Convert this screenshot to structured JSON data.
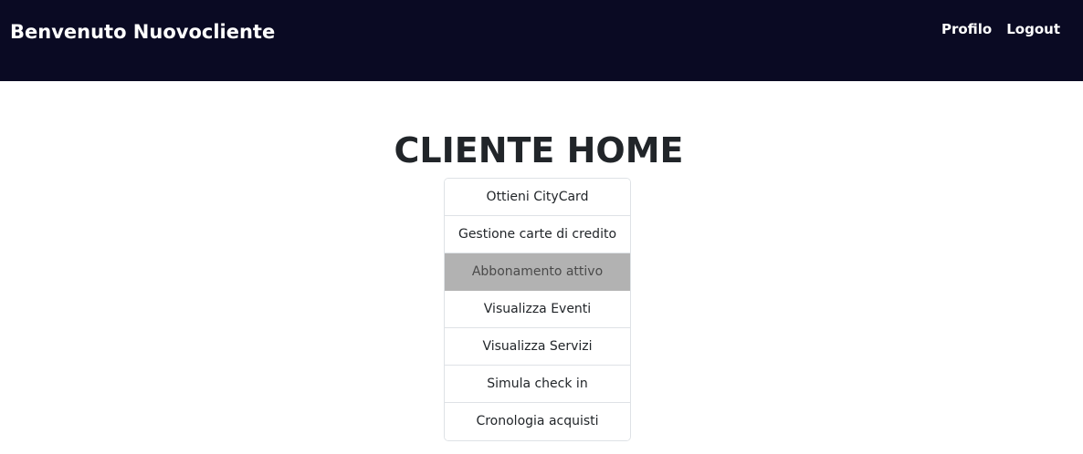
{
  "header": {
    "brand": "Benvenuto Nuovocliente",
    "links": [
      "Profilo",
      "Logout"
    ]
  },
  "main": {
    "title": "CLIENTE HOME",
    "menu": [
      {
        "label": "Ottieni CityCard",
        "active": false
      },
      {
        "label": "Gestione carte di credito",
        "active": false
      },
      {
        "label": "Abbonamento attivo",
        "active": true
      },
      {
        "label": "Visualizza Eventi",
        "active": false
      },
      {
        "label": "Visualizza Servizi",
        "active": false
      },
      {
        "label": "Simula check in",
        "active": false
      },
      {
        "label": "Cronologia acquisti",
        "active": false
      }
    ]
  },
  "colors": {
    "navbar_bg": "#0a0a23",
    "active_item_bg": "#b2b2b2",
    "text": "#212529"
  }
}
